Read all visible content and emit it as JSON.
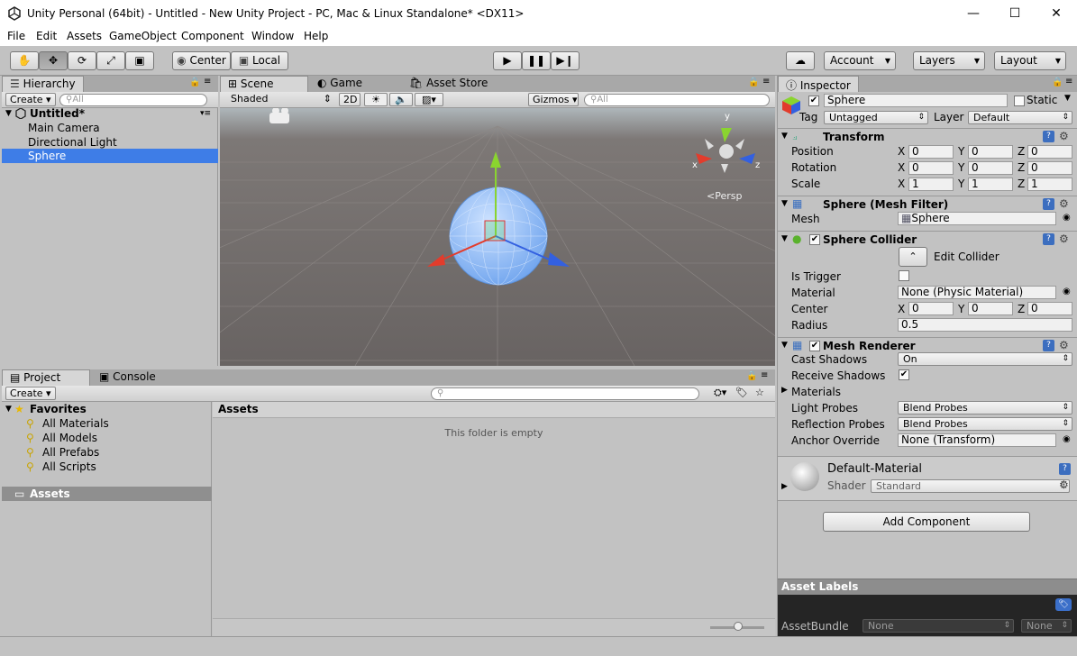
{
  "window": {
    "title": "Unity Personal (64bit) - Untitled - New Unity Project - PC, Mac & Linux Standalone* <DX11>",
    "minimize": "—",
    "maximize": "☐",
    "close": "✕"
  },
  "menu": [
    "File",
    "Edit",
    "Assets",
    "GameObject",
    "Component",
    "Window",
    "Help"
  ],
  "toolbar": {
    "pivot": "Center",
    "space": "Local",
    "account": "Account",
    "layers": "Layers",
    "layout": "Layout"
  },
  "hierarchy": {
    "tab": "Hierarchy",
    "create": "Create",
    "search_placeholder": "All",
    "scene": "Untitled*",
    "items": [
      "Main Camera",
      "Directional Light",
      "Sphere"
    ],
    "selected": "Sphere"
  },
  "scene_view": {
    "tabs": [
      "Scene",
      "Game",
      "Asset Store"
    ],
    "shading": "Shaded",
    "mode2d": "2D",
    "gizmos": "Gizmos",
    "search_placeholder": "All",
    "persp_label": "Persp",
    "axis_x": "x",
    "axis_y": "y",
    "axis_z": "z"
  },
  "project": {
    "tabs": [
      "Project",
      "Console"
    ],
    "create": "Create",
    "favorites_label": "Favorites",
    "favorites": [
      "All Materials",
      "All Models",
      "All Prefabs",
      "All Scripts"
    ],
    "assets_root": "Assets",
    "breadcrumb": "Assets",
    "empty_msg": "This folder is empty"
  },
  "inspector": {
    "tab": "Inspector",
    "object_name": "Sphere",
    "static_label": "Static",
    "tag_label": "Tag",
    "tag_value": "Untagged",
    "layer_label": "Layer",
    "layer_value": "Default",
    "transform": {
      "title": "Transform",
      "rows": [
        {
          "label": "Position",
          "x": "0",
          "y": "0",
          "z": "0"
        },
        {
          "label": "Rotation",
          "x": "0",
          "y": "0",
          "z": "0"
        },
        {
          "label": "Scale",
          "x": "1",
          "y": "1",
          "z": "1"
        }
      ]
    },
    "mesh_filter": {
      "title": "Sphere (Mesh Filter)",
      "mesh_label": "Mesh",
      "mesh_value": "Sphere"
    },
    "collider": {
      "title": "Sphere Collider",
      "edit_label": "Edit Collider",
      "is_trigger_label": "Is Trigger",
      "material_label": "Material",
      "material_value": "None (Physic Material)",
      "center_label": "Center",
      "cx": "0",
      "cy": "0",
      "cz": "0",
      "radius_label": "Radius",
      "radius_value": "0.5"
    },
    "renderer": {
      "title": "Mesh Renderer",
      "cast_label": "Cast Shadows",
      "cast_value": "On",
      "receive_label": "Receive Shadows",
      "materials_label": "Materials",
      "light_label": "Light Probes",
      "light_value": "Blend Probes",
      "reflection_label": "Reflection Probes",
      "reflection_value": "Blend Probes",
      "anchor_label": "Anchor Override",
      "anchor_value": "None (Transform)"
    },
    "material": {
      "name": "Default-Material",
      "shader_label": "Shader",
      "shader_value": "Standard"
    },
    "add_component": "Add Component",
    "asset_labels": "Asset Labels",
    "assetbundle_label": "AssetBundle",
    "assetbundle_value": "None",
    "variant_value": "None"
  }
}
